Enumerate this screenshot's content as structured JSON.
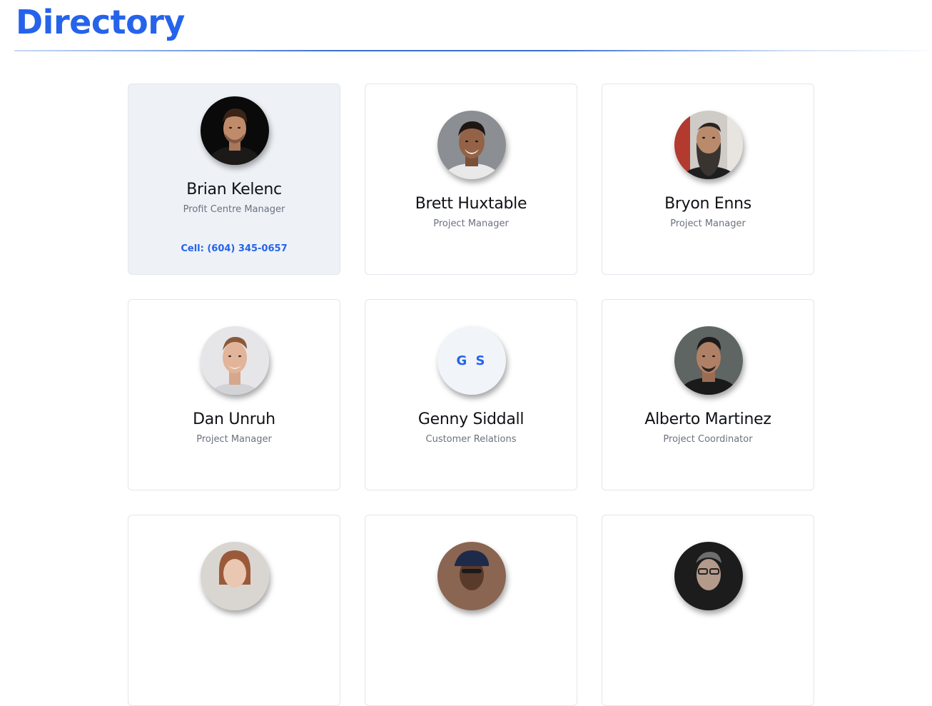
{
  "header": {
    "title": "Directory"
  },
  "accent": "#2563eb",
  "people": [
    {
      "name": "Brian Kelenc",
      "role": "Profit Centre Manager",
      "phone": "Cell: (604) 345-0657",
      "avatar": "photo-portrait-icon"
    },
    {
      "name": "Brett Huxtable",
      "role": "Project Manager",
      "avatar": "photo-portrait-icon"
    },
    {
      "name": "Bryon Enns",
      "role": "Project Manager",
      "avatar": "photo-portrait-icon"
    },
    {
      "name": "Dan Unruh",
      "role": "Project Manager",
      "avatar": "photo-portrait-icon"
    },
    {
      "name": "Genny Siddall",
      "role": "Customer Relations",
      "initials": "G S"
    },
    {
      "name": "Alberto Martinez",
      "role": "Project Coordinator",
      "avatar": "photo-portrait-icon"
    },
    {
      "avatar": "photo-portrait-icon"
    },
    {
      "avatar": "photo-portrait-icon"
    },
    {
      "avatar": "photo-portrait-icon"
    }
  ]
}
